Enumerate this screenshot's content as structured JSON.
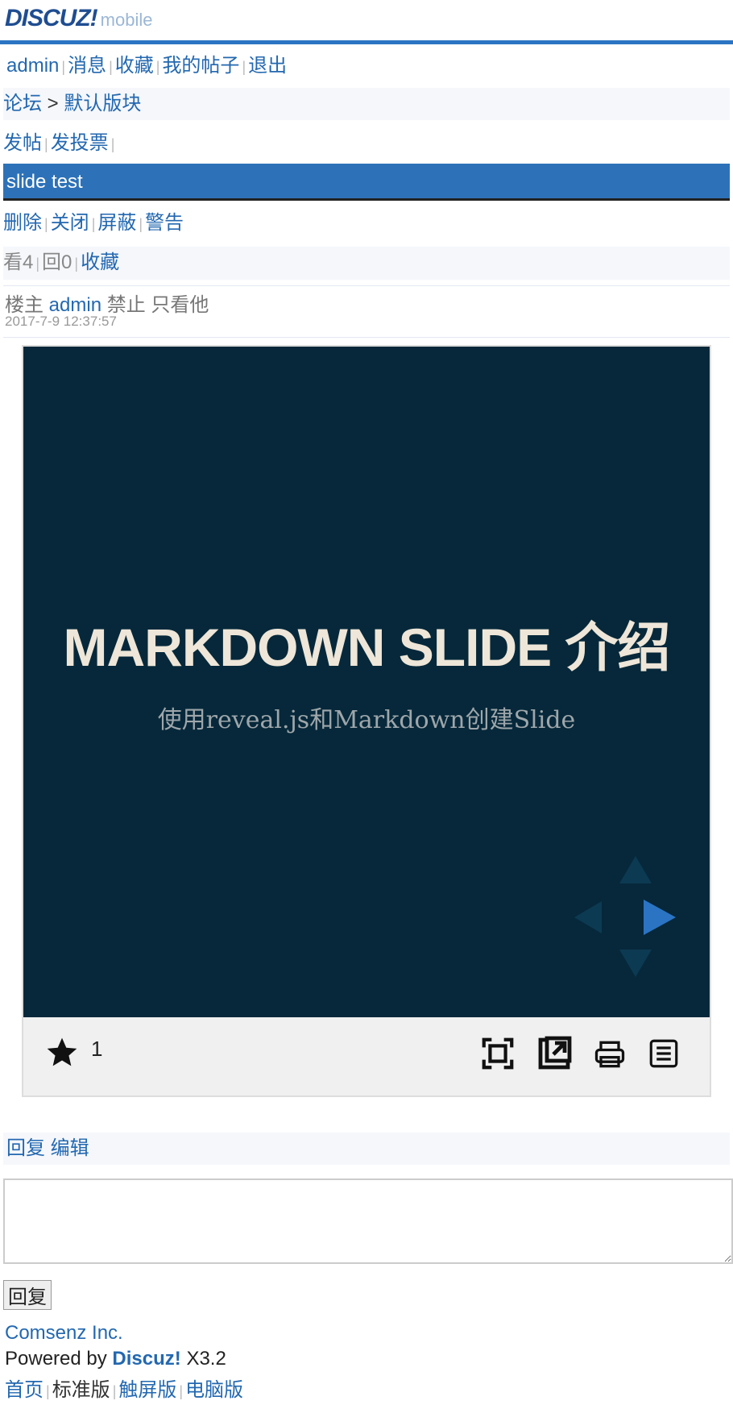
{
  "header": {
    "brand": "DISCUZ!",
    "brand_sub": "mobile"
  },
  "user_nav": {
    "items": [
      "admin",
      "消息",
      "收藏",
      "我的帖子",
      "退出"
    ]
  },
  "breadcrumb": {
    "root": "论坛",
    "separator": ">",
    "current": "默认版块"
  },
  "post_actions": {
    "new_thread": "发帖",
    "new_poll": "发投票"
  },
  "thread": {
    "title": "slide test"
  },
  "mod_actions": {
    "items": [
      "删除",
      "关闭",
      "屏蔽",
      "警告"
    ]
  },
  "stats": {
    "views": "看4",
    "replies": "回0",
    "favorite": "收藏"
  },
  "post_meta": {
    "role": "楼主",
    "author": "admin",
    "ban": "禁止",
    "only_him": "只看他",
    "time": "2017-7-9 12:37:57"
  },
  "slide": {
    "title": "MARKDOWN SLIDE 介绍",
    "subtitle": "使用reveal.js和Markdown创建Slide",
    "star_count": "1",
    "icons": [
      "star-icon",
      "fullscreen-icon",
      "popout-icon",
      "print-icon",
      "list-icon"
    ],
    "bg_color": "#06283a",
    "accent_color": "#2b74c4"
  },
  "reply_bar": {
    "reply": "回复",
    "edit": "编辑"
  },
  "reply_form": {
    "submit_label": "回复",
    "placeholder": ""
  },
  "footer": {
    "company": "Comsenz Inc.",
    "powered_prefix": "Powered by",
    "powered_brand": "Discuz!",
    "version": "X3.2",
    "links": [
      "首页",
      "标准版",
      "触屏版",
      "电脑版"
    ]
  }
}
